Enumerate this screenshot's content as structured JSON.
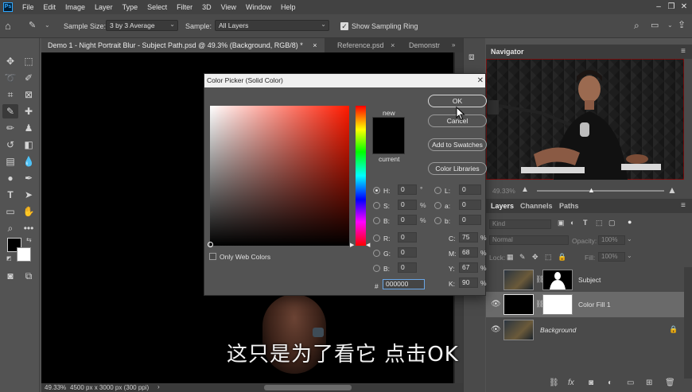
{
  "menu": {
    "logo": "Ps",
    "items": [
      "File",
      "Edit",
      "Image",
      "Layer",
      "Type",
      "Select",
      "Filter",
      "3D",
      "View",
      "Window",
      "Help"
    ]
  },
  "options_bar": {
    "sample_size_label": "Sample Size:",
    "sample_size_value": "3 by 3 Average",
    "sample_label": "Sample:",
    "sample_value": "All Layers",
    "show_ring_label": "Show Sampling Ring"
  },
  "tabs": [
    {
      "label": "Demo 1 - Night Portrait Blur - Subject Path.psd @ 49.3% (Background, RGB/8) *",
      "close": "×"
    },
    {
      "label": "Reference.psd",
      "close": "×"
    },
    {
      "label": "Demonstr"
    }
  ],
  "subtitle": "这只是为了看它 点击OK",
  "status_bar": {
    "zoom": "49.33%",
    "doc_info": "4500 px x 3000 px (300 ppi)"
  },
  "navigator": {
    "title": "Navigator",
    "zoom": "49.33%"
  },
  "layers_panel": {
    "tabs": [
      "Layers",
      "Channels",
      "Paths"
    ],
    "kind_label": "Kind",
    "blend_mode": "Normal",
    "opacity_label": "Opacity:",
    "opacity_value": "100%",
    "lock_label": "Lock:",
    "fill_label": "Fill:",
    "fill_value": "100%",
    "layers": [
      {
        "name": "Subject",
        "visible": false
      },
      {
        "name": "Color Fill 1",
        "visible": true
      },
      {
        "name": "Background",
        "visible": true
      }
    ]
  },
  "color_picker": {
    "title": "Color Picker (Solid Color)",
    "ok": "OK",
    "cancel": "Cancel",
    "add_swatches": "Add to Swatches",
    "color_libraries": "Color Libraries",
    "new_label": "new",
    "current_label": "current",
    "only_web_colors": "Only Web Colors",
    "hsb": {
      "H": "0",
      "S": "0",
      "B": "0"
    },
    "rgb": {
      "R": "0",
      "G": "0",
      "B": "0"
    },
    "lab": {
      "L": "0",
      "a": "0",
      "b": "0"
    },
    "cmyk": {
      "C": "75",
      "M": "68",
      "Y": "67",
      "K": "90"
    },
    "hex": "000000",
    "new_color": "#000000",
    "current_color": "#000000"
  }
}
